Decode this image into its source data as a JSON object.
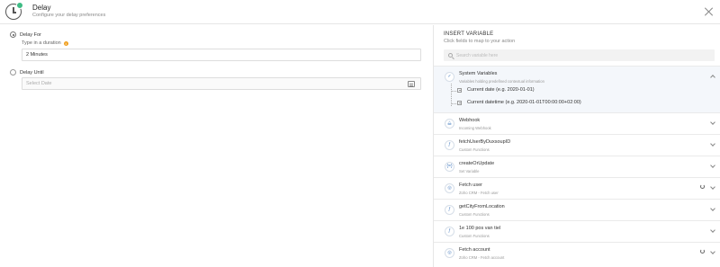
{
  "header": {
    "title": "Delay",
    "subtitle": "Configure your delay preferences",
    "icon": "clock-icon"
  },
  "delay_for": {
    "label": "Delay For",
    "selected": true,
    "hint": "Type in a duration",
    "value": "2 Minutes"
  },
  "delay_until": {
    "label": "Delay Until",
    "selected": false,
    "placeholder": "Select Date"
  },
  "insert_variable": {
    "title": "INSERT VARIABLE",
    "subtitle": "Click fields to map to your action",
    "search_placeholder": "Search variable here"
  },
  "groups": [
    {
      "name": "System Variables",
      "desc": "Variables holding predefined contextual information",
      "icon": "check-circle-icon",
      "glyph": "✓",
      "expanded": true
    },
    {
      "name": "Webhook",
      "desc": "Incoming Webhook",
      "icon": "webhook-icon",
      "glyph": "⧋"
    },
    {
      "name": "fetchUserByDuxsoupID",
      "desc": "Custom Functions",
      "icon": "function-icon",
      "glyph": "ƒ"
    },
    {
      "name": "createOrUpdate",
      "desc": "Set Variable",
      "icon": "set-variable-icon",
      "glyph": "{=}"
    },
    {
      "name": "Fetch user",
      "desc": "Zoho CRM - Fetch user",
      "icon": "zoho-crm-icon",
      "glyph": "◎",
      "refresh": true
    },
    {
      "name": "getCityFromLocation",
      "desc": "Custom Functions",
      "icon": "function-icon",
      "glyph": "ƒ"
    },
    {
      "name": "1e 100 pos van tiel",
      "desc": "Custom Functions",
      "icon": "function-icon",
      "glyph": "ƒ"
    },
    {
      "name": "Fetch account",
      "desc": "Zoho CRM - Fetch account",
      "icon": "zoho-crm-icon",
      "glyph": "◎",
      "refresh": true
    }
  ],
  "system_variables": [
    {
      "label": "Current date (e.g. 2020-01-01)"
    },
    {
      "label": "Current datetime (e.g. 2020-01-01T00:00:00+02:00)"
    }
  ]
}
